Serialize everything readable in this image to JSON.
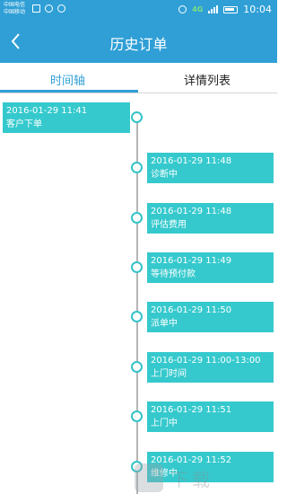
{
  "status_bar": {
    "carrier_line1": "中国电信",
    "carrier_line2": "中国移动",
    "network": "4G",
    "time": "10:04"
  },
  "header": {
    "title": "历史订单",
    "back_icon": "chevron-left-icon"
  },
  "tabs": [
    {
      "label": "时间轴",
      "active": true
    },
    {
      "label": "详情列表",
      "active": false
    }
  ],
  "timeline": [
    {
      "time": "2016-01-29 11:41",
      "status": "客户下单"
    },
    {
      "time": "2016-01-29 11:48",
      "status": "诊断中"
    },
    {
      "time": "2016-01-29 11:48",
      "status": "评估费用"
    },
    {
      "time": "2016-01-29 11:49",
      "status": "等待预付款"
    },
    {
      "time": "2016-01-29 11:50",
      "status": "派单中"
    },
    {
      "time": "2016-01-29 11:00-13:00",
      "status": "上门时间"
    },
    {
      "time": "2016-01-29 11:51",
      "status": "上门中"
    },
    {
      "time": "2016-01-29 11:52",
      "status": "维修中"
    }
  ],
  "watermark": {
    "text": "下载"
  },
  "colors": {
    "accent": "#2f9fd6",
    "card": "#35c9cd",
    "line": "#b5b5b5"
  }
}
